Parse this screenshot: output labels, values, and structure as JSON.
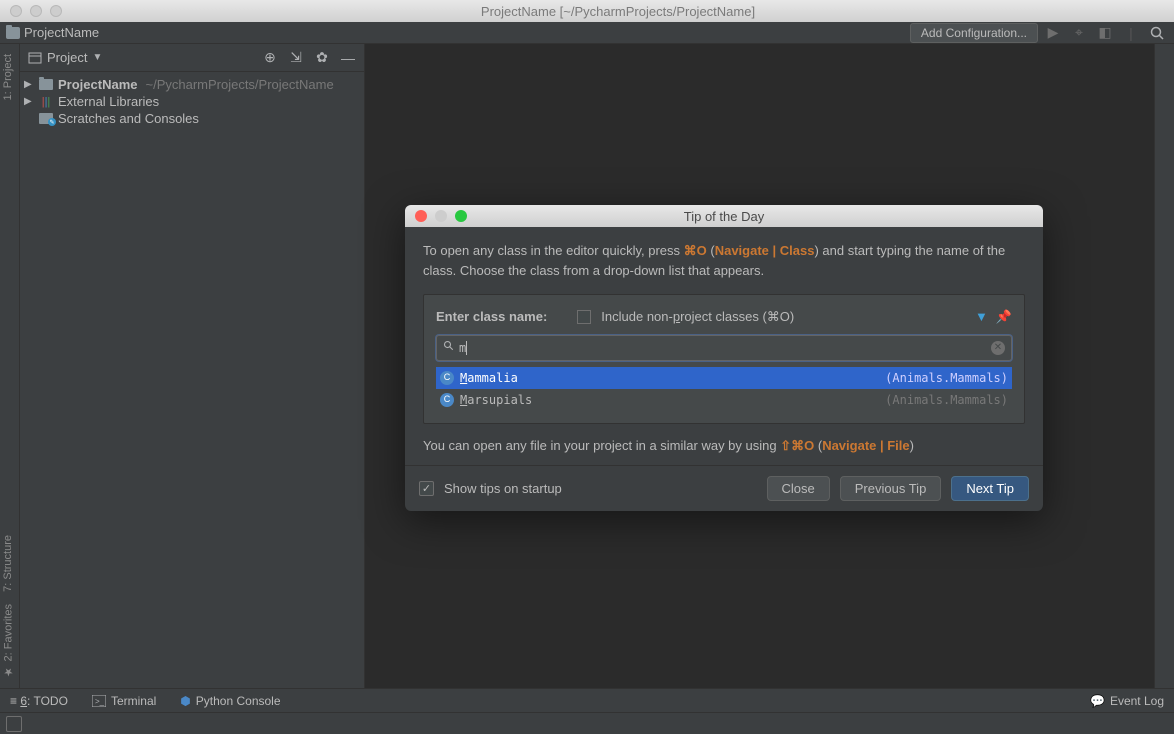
{
  "titlebar": {
    "text": "ProjectName [~/PycharmProjects/ProjectName]"
  },
  "navbar": {
    "breadcrumb": "ProjectName",
    "add_config": "Add Configuration..."
  },
  "left_gutter": {
    "project": "1: Project",
    "structure": "7: Structure",
    "favorites": "2: Favorites"
  },
  "project_panel": {
    "title": "Project",
    "tree": {
      "root_name": "ProjectName",
      "root_path": "~/PycharmProjects/ProjectName",
      "external_libs": "External Libraries",
      "scratches": "Scratches and Consoles"
    }
  },
  "bottom": {
    "todo_num": "6",
    "todo_label": ": TODO",
    "terminal": "Terminal",
    "python_console": "Python Console",
    "event_log": "Event Log"
  },
  "dialog": {
    "title": "Tip of the Day",
    "tip_pre": "To open any class in the editor quickly, press ",
    "shortcut1": "⌘O",
    "tip_mid": " (",
    "nav_class": "Navigate | Class",
    "tip_post": ") and start typing the name of the class. Choose the class from a drop-down list that appears.",
    "demo": {
      "label": "Enter class name:",
      "checkbox_label_pre": "Include non-",
      "checkbox_label_ul": "p",
      "checkbox_label_post": "roject classes (⌘O)",
      "search_value": "m",
      "rows": [
        {
          "name_hl": "M",
          "name_rest": "ammalia",
          "pkg": "(Animals.Mammals)",
          "selected": true
        },
        {
          "name_hl": "M",
          "name_rest": "arsupials",
          "pkg": "(Animals.Mammals)",
          "selected": false
        }
      ]
    },
    "tip2_pre": "You can open any file in your project in a similar way by using ",
    "shortcut2": "⇧⌘O",
    "tip2_mid": " (",
    "nav_file": "Navigate | File",
    "tip2_post": ")",
    "show_tips": "Show tips on startup",
    "btn_close": "Close",
    "btn_prev": "Previous Tip",
    "btn_next": "Next Tip"
  }
}
